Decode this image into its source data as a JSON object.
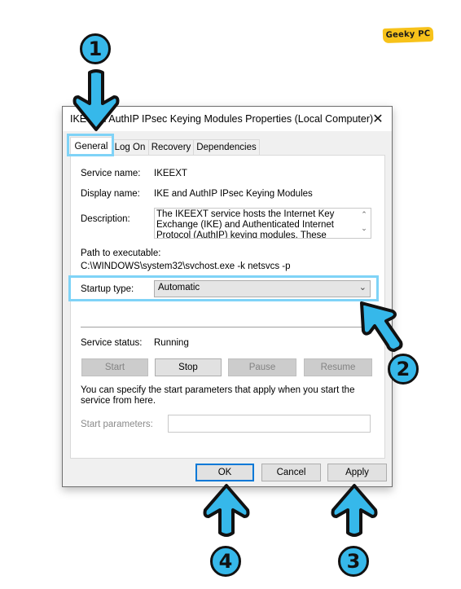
{
  "logo": {
    "text": "Geeky PC",
    "color": "#f7c21a"
  },
  "dialog": {
    "title": "IKE and AuthIP IPsec Keying Modules Properties (Local Computer)",
    "close_icon": "close-icon",
    "tabs": [
      {
        "label": "General",
        "active": true
      },
      {
        "label": "Log On",
        "active": false
      },
      {
        "label": "Recovery",
        "active": false
      },
      {
        "label": "Dependencies",
        "active": false
      }
    ],
    "general": {
      "service_name_label": "Service name:",
      "service_name_value": "IKEEXT",
      "display_name_label": "Display name:",
      "display_name_value": "IKE and AuthIP IPsec Keying Modules",
      "description_label": "Description:",
      "description_value": "The IKEEXT service hosts the Internet Key Exchange (IKE) and Authenticated Internet Protocol (AuthIP) keying modules. These keying modules are",
      "path_label": "Path to executable:",
      "path_value": "C:\\WINDOWS\\system32\\svchost.exe -k netsvcs -p",
      "startup_type_label": "Startup type:",
      "startup_type_value": "Automatic",
      "service_status_label": "Service status:",
      "service_status_value": "Running",
      "control_buttons": [
        {
          "label": "Start",
          "enabled": false
        },
        {
          "label": "Stop",
          "enabled": true
        },
        {
          "label": "Pause",
          "enabled": false
        },
        {
          "label": "Resume",
          "enabled": false
        }
      ],
      "start_params_help": "You can specify the start parameters that apply when you start the service from here.",
      "start_params_label": "Start parameters:",
      "start_params_value": ""
    },
    "footer_buttons": {
      "ok": "OK",
      "cancel": "Cancel",
      "apply": "Apply"
    }
  },
  "annotations": {
    "accent_color": "#36b8ea",
    "highlight_color": "#7fd3f7",
    "steps": [
      "1",
      "2",
      "3",
      "4"
    ]
  }
}
